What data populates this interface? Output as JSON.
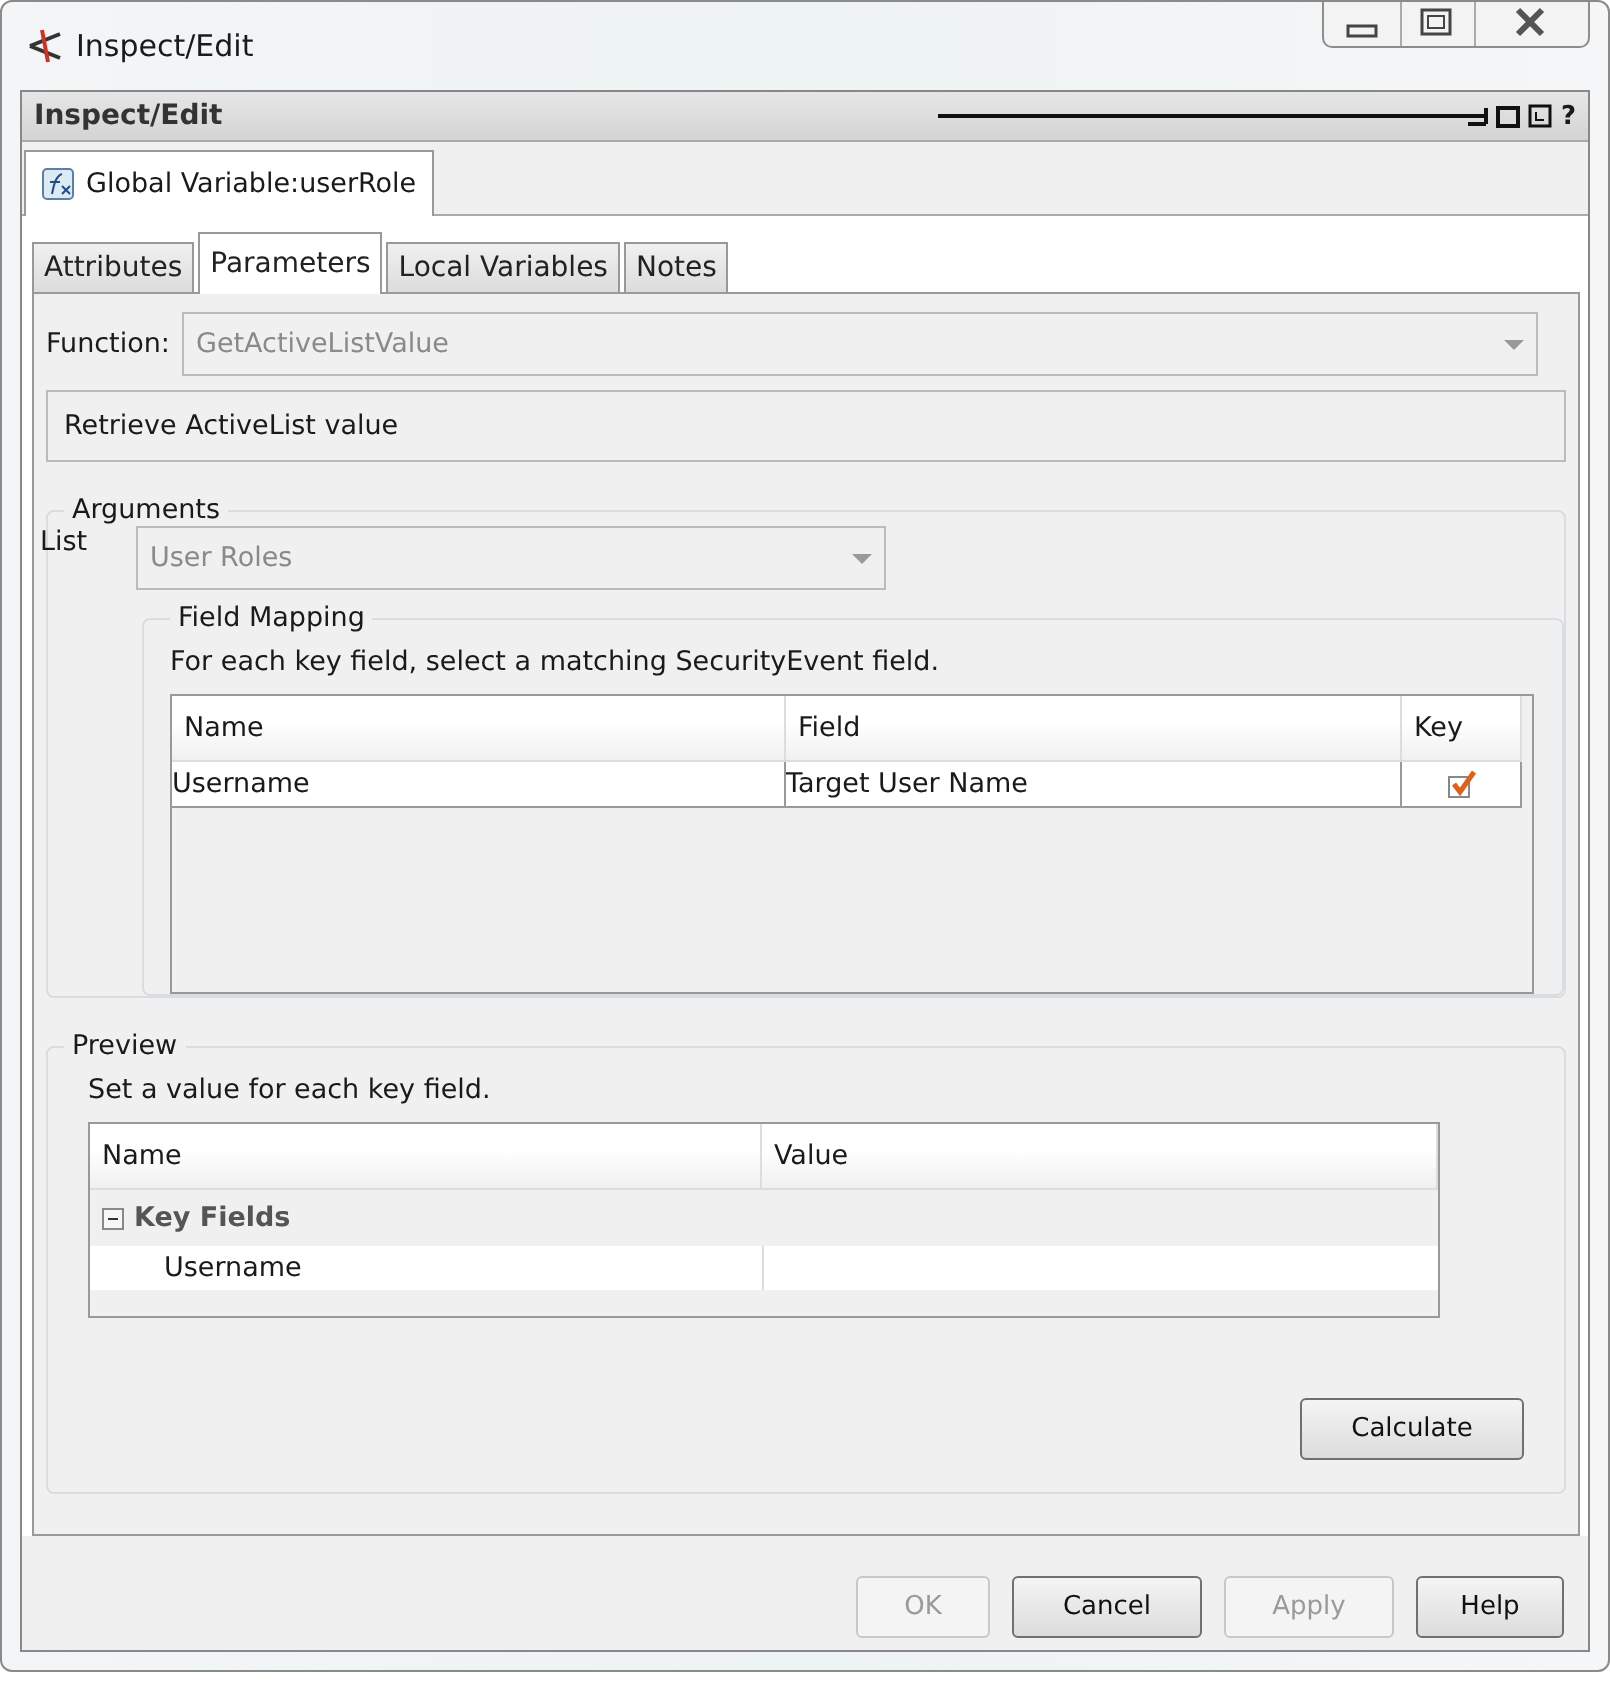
{
  "window": {
    "title": "Inspect/Edit"
  },
  "panel": {
    "title": "Inspect/Edit",
    "help_glyph": "?"
  },
  "document_tab": {
    "label": "Global Variable:userRole"
  },
  "tabs": [
    {
      "label": "Attributes",
      "selected": false
    },
    {
      "label": "Parameters",
      "selected": true
    },
    {
      "label": "Local Variables",
      "selected": false
    },
    {
      "label": "Notes",
      "selected": false
    }
  ],
  "function": {
    "label": "Function:",
    "value": "GetActiveListValue",
    "disabled": true
  },
  "description": "Retrieve ActiveList value",
  "arguments": {
    "title": "Arguments",
    "list_label": "List",
    "list_value": "User Roles",
    "list_disabled": true,
    "field_mapping": {
      "title": "Field Mapping",
      "instruction": "For each key field, select a matching SecurityEvent field.",
      "columns": [
        "Name",
        "Field",
        "Key"
      ],
      "rows": [
        {
          "name": "Username",
          "field": "Target User Name",
          "key": true
        }
      ]
    }
  },
  "preview": {
    "title": "Preview",
    "instruction": "Set a value for each key field.",
    "columns": [
      "Name",
      "Value"
    ],
    "groups": [
      {
        "label": "Key Fields",
        "expanded": true,
        "children": [
          {
            "name": "Username"
          }
        ]
      }
    ],
    "button": "Calculate"
  },
  "buttons": [
    {
      "label": "OK",
      "disabled": true
    },
    {
      "label": "Cancel",
      "disabled": false
    },
    {
      "label": "Apply",
      "disabled": true
    },
    {
      "label": "Help",
      "disabled": false
    }
  ]
}
